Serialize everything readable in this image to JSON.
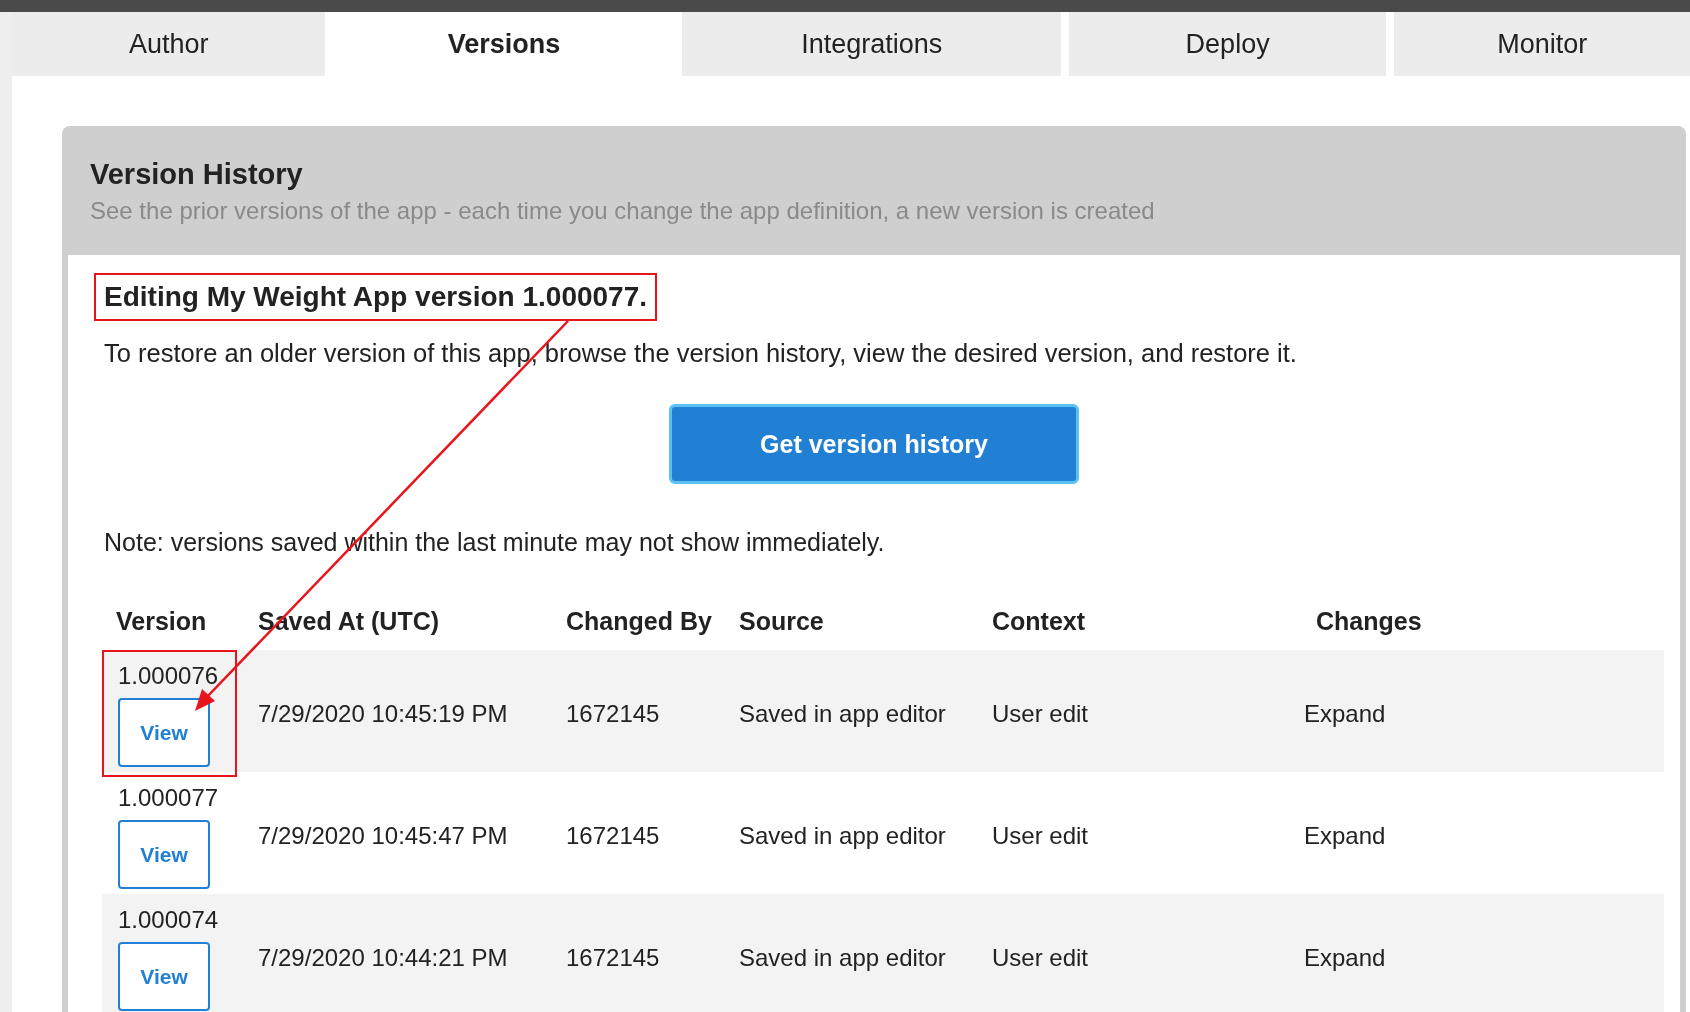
{
  "tabs": [
    {
      "label": "Author",
      "selected": false
    },
    {
      "label": "Versions",
      "selected": true
    },
    {
      "label": "Integrations",
      "selected": false
    },
    {
      "label": "Deploy",
      "selected": false
    },
    {
      "label": "Monitor",
      "selected": false
    }
  ],
  "panel": {
    "title": "Version History",
    "subtitle": "See the prior versions of the app - each time you change the app definition, a new version is created"
  },
  "card": {
    "heading": "Editing My Weight App version 1.000077.",
    "heading_highlighted": true,
    "intro": "To restore an older version of this app, browse the version history, view the desired version, and restore it.",
    "button": "Get version history",
    "note": "Note: versions saved within the last minute may not show immediately."
  },
  "table": {
    "columns": [
      "Version",
      "Saved At (UTC)",
      "Changed By",
      "Source",
      "Context",
      "Changes"
    ],
    "rows": [
      {
        "version": "1.000076",
        "action": "View",
        "saved_at": "7/29/2020 10:45:19 PM",
        "changed_by": "1672145",
        "source": "Saved in app editor",
        "context": "User edit",
        "changes": "Expand",
        "highlighted": true
      },
      {
        "version": "1.000077",
        "action": "View",
        "saved_at": "7/29/2020 10:45:47 PM",
        "changed_by": "1672145",
        "source": "Saved in app editor",
        "context": "User edit",
        "changes": "Expand",
        "highlighted": false
      },
      {
        "version": "1.000074",
        "action": "View",
        "saved_at": "7/29/2020 10:44:21 PM",
        "changed_by": "1672145",
        "source": "Saved in app editor",
        "context": "User edit",
        "changes": "Expand",
        "highlighted": false
      }
    ]
  }
}
